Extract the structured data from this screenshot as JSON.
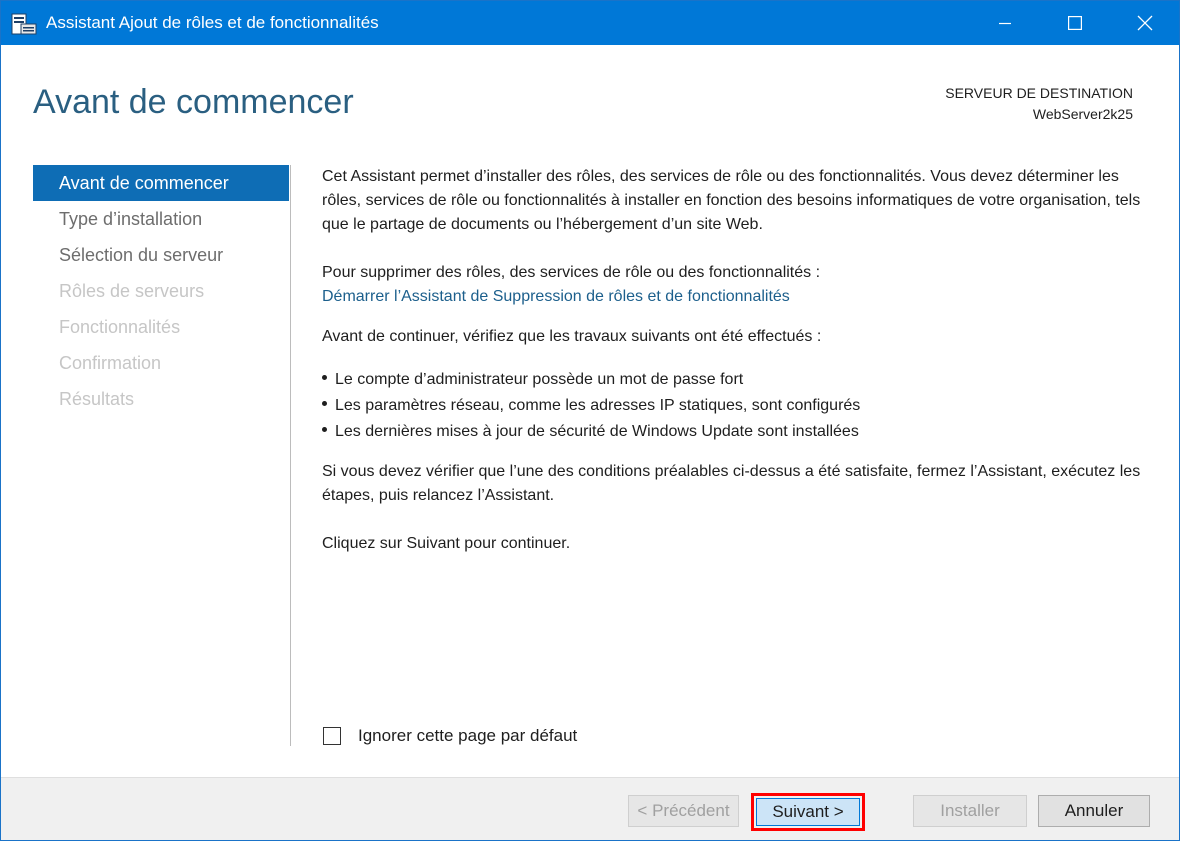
{
  "window": {
    "title": "Assistant Ajout de rôles et de fonctionnalités"
  },
  "header": {
    "page_title": "Avant de commencer",
    "destination_label": "SERVEUR DE DESTINATION",
    "destination_server": "WebServer2k25"
  },
  "sidebar": {
    "items": [
      {
        "label": "Avant de commencer",
        "state": "active"
      },
      {
        "label": "Type d’installation",
        "state": "enabled"
      },
      {
        "label": "Sélection du serveur",
        "state": "enabled"
      },
      {
        "label": "Rôles de serveurs",
        "state": "disabled"
      },
      {
        "label": "Fonctionnalités",
        "state": "disabled"
      },
      {
        "label": "Confirmation",
        "state": "disabled"
      },
      {
        "label": "Résultats",
        "state": "disabled"
      }
    ]
  },
  "content": {
    "intro": "Cet Assistant permet d’installer des rôles, des services de rôle ou des fonctionnalités. Vous devez déterminer les rôles, services de rôle ou fonctionnalités à installer en fonction des besoins informatiques de votre organisation, tels que le partage de documents ou l’hébergement d’un site Web.",
    "remove_text": "Pour supprimer des rôles, des services de rôle ou des fonctionnalités :",
    "remove_link": "Démarrer l’Assistant de Suppression de rôles et de fonctionnalités",
    "before_text": "Avant de continuer, vérifiez que les travaux suivants ont été effectués :",
    "bullets": [
      "Le compte d’administrateur possède un mot de passe fort",
      "Les paramètres réseau, comme les adresses IP statiques, sont configurés",
      "Les dernières mises à jour de sécurité de Windows Update sont installées"
    ],
    "check_text": "Si vous devez vérifier que l’une des conditions préalables ci-dessus a été satisfaite, fermez l’Assistant, exécutez les étapes, puis relancez l’Assistant.",
    "click_text": "Cliquez sur Suivant pour continuer.",
    "skip_label": "Ignorer cette page par défaut",
    "skip_checked": false
  },
  "footer": {
    "prev_label": "< Précédent",
    "next_label": "Suivant >",
    "install_label": "Installer",
    "cancel_label": "Annuler"
  },
  "colors": {
    "titlebar": "#0078d7",
    "accent": "#0e6db5",
    "title_text": "#2a5f81",
    "link": "#1c5f8c",
    "highlight": "#ff0000"
  }
}
